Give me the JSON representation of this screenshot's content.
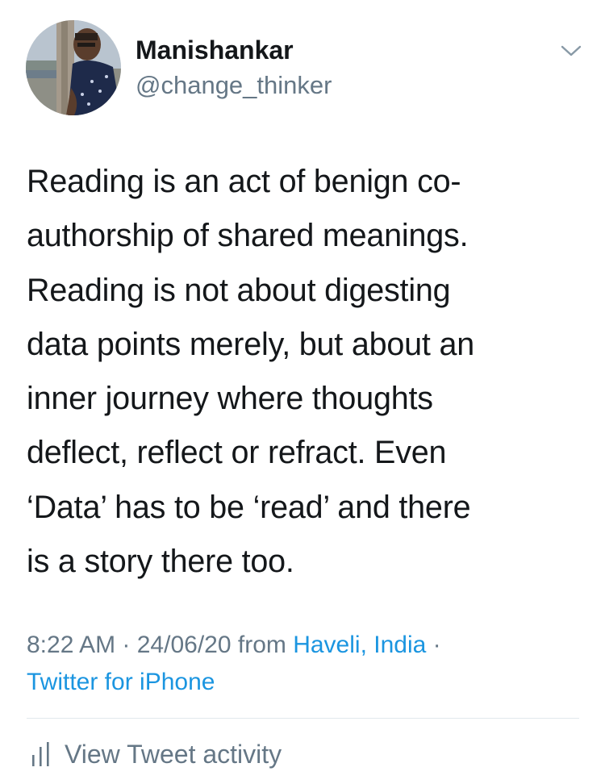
{
  "author": {
    "name": "Manishankar",
    "handle": "@change_thinker"
  },
  "tweet": {
    "text": "Reading is an act of benign co-\nauthorship of shared meanings.\nReading is not about digesting\ndata points merely, but about an\ninner journey where thoughts\ndeflect, reflect or refract. Even\n‘Data’ has to be ‘read’ and there\nis a story there too.",
    "time": "8:22 AM",
    "separator": " · ",
    "date": "24/06/20",
    "from_label": " from ",
    "location": "Haveli, India",
    "separator2": " ·",
    "source": "Twitter for iPhone"
  },
  "actions": {
    "activity_label": "View Tweet activity"
  },
  "icons": {
    "menu": "chevron-down-icon",
    "activity": "bar-chart-icon"
  },
  "colors": {
    "text": "#14171a",
    "secondary": "#657786",
    "link": "#1b95e0",
    "divider": "#e1e8ed"
  }
}
